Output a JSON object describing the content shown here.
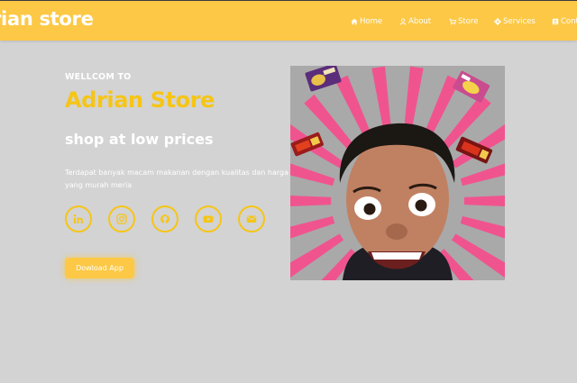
{
  "header": {
    "brand": "rian store",
    "nav": [
      {
        "label": "Home",
        "icon": "home-icon"
      },
      {
        "label": "About",
        "icon": "user-icon"
      },
      {
        "label": "Store",
        "icon": "cart-icon"
      },
      {
        "label": "Services",
        "icon": "gear-icon"
      },
      {
        "label": "Cont",
        "icon": "contact-icon"
      }
    ]
  },
  "hero": {
    "welcome": "WELLCOM TO",
    "title": "Adrian Store",
    "tagline": "shop at low prices",
    "description": "Terdapat banyak macam makanan dengan kualitas dan harga yang murah meria",
    "button_label": "Dowload App",
    "socials": [
      "linkedin-icon",
      "instagram-icon",
      "github-icon",
      "youtube-icon",
      "mail-icon"
    ]
  },
  "colors": {
    "header_bg": "#fcc846",
    "accent": "#f6c515",
    "page_bg": "#d3d3d3",
    "text_light": "#ffffff",
    "sunburst": "#f0548f"
  }
}
